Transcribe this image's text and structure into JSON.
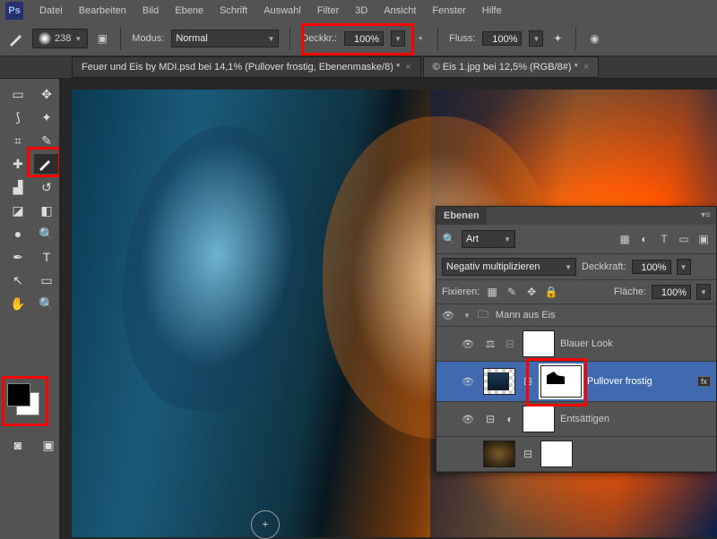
{
  "app": {
    "logo": "Ps"
  },
  "menu": [
    "Datei",
    "Bearbeiten",
    "Bild",
    "Ebene",
    "Schrift",
    "Auswahl",
    "Filter",
    "3D",
    "Ansicht",
    "Fenster",
    "Hilfe"
  ],
  "options": {
    "brush_size": "238",
    "mode_label": "Modus:",
    "mode_value": "Normal",
    "opacity_label": "Deckkr.:",
    "opacity_value": "100%",
    "flow_label": "Fluss:",
    "flow_value": "100%"
  },
  "tabs": [
    {
      "label": "Feuer und Eis by MDI.psd bei 14,1% (Pullover frostig, Ebenenmaske/8) *",
      "active": true
    },
    {
      "label": "© Eis 1.jpg bei 12,5% (RGB/8#) *",
      "active": false
    }
  ],
  "tool_icons": [
    "move",
    "marquee",
    "lasso",
    "wand",
    "crop",
    "eyedrop",
    "patch",
    "brush",
    "stamp",
    "history",
    "eraser",
    "gradient",
    "blur",
    "dodge",
    "pen",
    "type",
    "path",
    "shape",
    "hand",
    "zoom"
  ],
  "swatch": {
    "fg": "#000000",
    "bg": "#ffffff"
  },
  "layers_panel": {
    "title": "Ebenen",
    "kind_label": "Art",
    "blend_mode": "Negativ multiplizieren",
    "opacity_label": "Deckkraft:",
    "opacity_value": "100%",
    "lock_label": "Fixieren:",
    "fill_label": "Fläche:",
    "fill_value": "100%",
    "group_name": "Mann aus Eis",
    "layers": [
      {
        "name": "Blauer Look",
        "mask": true,
        "adj": true
      },
      {
        "name": "Pullover frostig",
        "mask": true,
        "selected": true,
        "fx": true
      },
      {
        "name": "Entsättigen",
        "mask": true,
        "adj": true
      },
      {
        "name": "",
        "tex": true
      }
    ]
  }
}
